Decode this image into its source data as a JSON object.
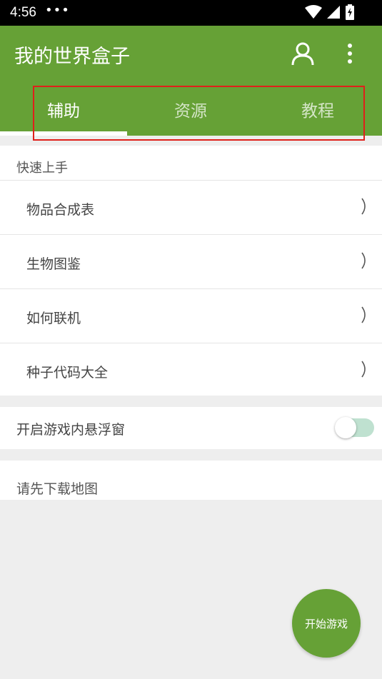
{
  "status_bar": {
    "time": "4:56",
    "dots": "•••",
    "wifi_icon": "wifi-icon",
    "signal_icon": "signal-icon",
    "battery_icon": "battery-charging-icon"
  },
  "header": {
    "title": "我的世界盒子",
    "profile_icon": "person-outline-icon",
    "more_icon": "vertical-dots-icon"
  },
  "tabs": [
    {
      "label": "辅助",
      "active": true
    },
    {
      "label": "资源",
      "active": false
    },
    {
      "label": "教程",
      "active": false
    }
  ],
  "quick_start": {
    "header": "快速上手",
    "items": [
      {
        "label": "物品合成表"
      },
      {
        "label": "生物图鉴"
      },
      {
        "label": "如何联机"
      },
      {
        "label": "种子代码大全"
      }
    ]
  },
  "floating_window": {
    "label": "开启游戏内悬浮窗",
    "enabled": false
  },
  "map_notice": {
    "text": "请先下载地图"
  },
  "fab": {
    "label": "开始游戏"
  },
  "colors": {
    "primary": "#66a136",
    "background": "#eeeeee",
    "toggle_track": "#bfe1d0",
    "highlight": "#e0201b"
  }
}
